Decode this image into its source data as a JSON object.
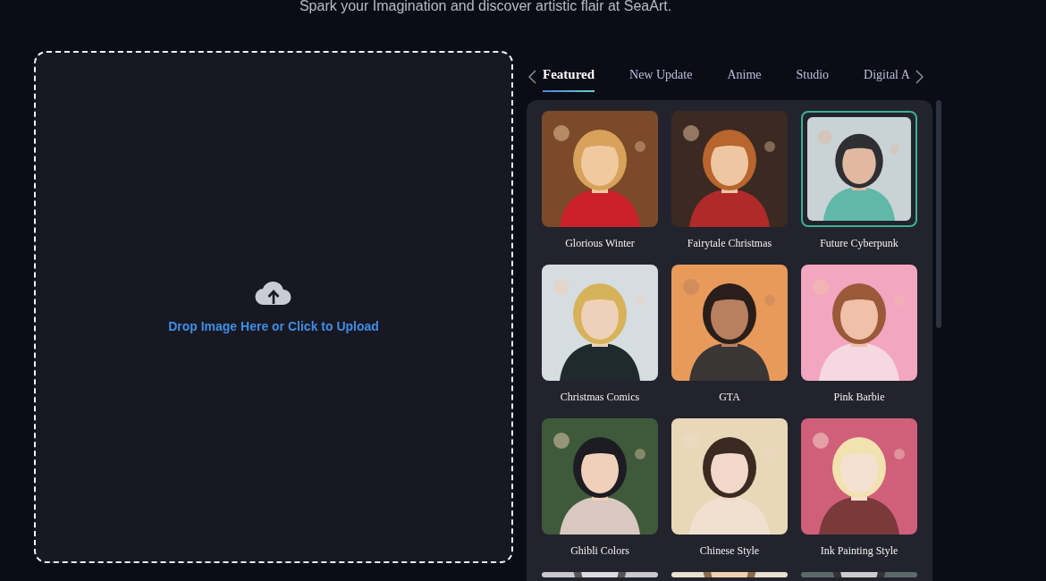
{
  "subtitle": "Spark your Imagination and discover artistic flair at SeaArt.",
  "upload": {
    "label": "Drop Image Here or Click to Upload"
  },
  "tabs": [
    {
      "label": "Featured",
      "selected": true
    },
    {
      "label": "New Update",
      "selected": false
    },
    {
      "label": "Anime",
      "selected": false
    },
    {
      "label": "Studio",
      "selected": false
    },
    {
      "label": "Digital A",
      "selected": false
    }
  ],
  "styles": [
    {
      "name": "Glorious Winter",
      "selected": false
    },
    {
      "name": "Fairytale Christmas",
      "selected": false
    },
    {
      "name": "Future Cyberpunk",
      "selected": true
    },
    {
      "name": "Christmas Comics",
      "selected": false
    },
    {
      "name": "GTA",
      "selected": false
    },
    {
      "name": "Pink Barbie",
      "selected": false
    },
    {
      "name": "Ghibli Colors",
      "selected": false
    },
    {
      "name": "Chinese Style",
      "selected": false
    },
    {
      "name": "Ink Painting Style",
      "selected": false
    },
    {
      "kind": "picture",
      "selected": false
    },
    {
      "kind": "picture",
      "selected": false
    },
    {
      "kind": "picture",
      "selected": false
    }
  ]
}
